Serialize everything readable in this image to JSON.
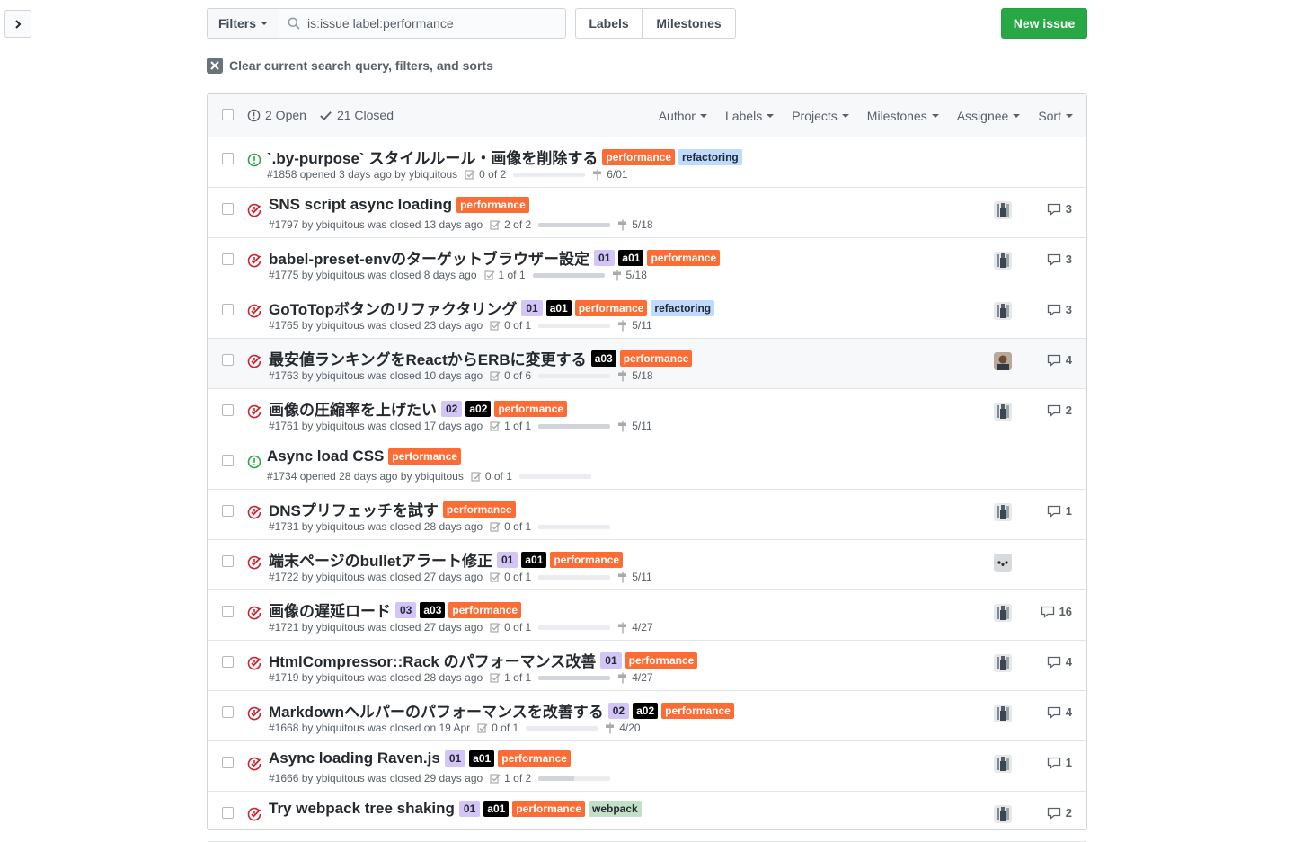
{
  "search": {
    "filters_label": "Filters",
    "query": "is:issue label:performance"
  },
  "nav": {
    "labels": "Labels",
    "milestones": "Milestones",
    "new_issue": "New issue"
  },
  "clear_query": "Clear current search query, filters, and sorts",
  "states": {
    "open": "2 Open",
    "closed": "21 Closed"
  },
  "header_filters": [
    "Author",
    "Labels",
    "Projects",
    "Milestones",
    "Assignee",
    "Sort"
  ],
  "colors": {
    "performance": "#fc6c35",
    "refactoring": "#bfdaff",
    "open": "#28a745",
    "closed": "#cb2431",
    "new_issue": "#28a745"
  },
  "issues": [
    {
      "title": "`.by-purpose` スタイルルール・画像を削除する",
      "state": "open",
      "labels": [
        "performance",
        "refactoring"
      ],
      "meta": "#1858 opened 3 days ago by ybiquitous",
      "tasks": "0 of 2",
      "progress": 0,
      "milestone": "6/01",
      "comments": "",
      "avatar": "none"
    },
    {
      "title": "SNS script async loading",
      "state": "closed",
      "labels": [
        "performance"
      ],
      "meta": "#1797 by ybiquitous was closed 13 days ago",
      "tasks": "2 of 2",
      "progress": 1,
      "milestone": "5/18",
      "comments": "3",
      "avatar": "person"
    },
    {
      "title": "babel-preset-envのターゲットブラウザー設定",
      "state": "closed",
      "labels": [
        "01",
        "a01",
        "performance"
      ],
      "meta": "#1775 by ybiquitous was closed 8 days ago",
      "tasks": "1 of 1",
      "progress": 1,
      "milestone": "5/18",
      "comments": "3",
      "avatar": "person"
    },
    {
      "title": "GoToTopボタンのリファクタリング",
      "state": "closed",
      "labels": [
        "01",
        "a01",
        "performance",
        "refactoring"
      ],
      "meta": "#1765 by ybiquitous was closed 23 days ago",
      "tasks": "0 of 1",
      "progress": 0,
      "milestone": "5/11",
      "comments": "3",
      "avatar": "person"
    },
    {
      "title": "最安値ランキングをReactからERBに変更する",
      "state": "closed",
      "labels": [
        "a03",
        "performance"
      ],
      "meta": "#1763 by ybiquitous was closed 10 days ago",
      "tasks": "0 of 6",
      "progress": 0,
      "milestone": "5/18",
      "comments": "4",
      "avatar": "photo",
      "highlight": true
    },
    {
      "title": "画像の圧縮率を上げたい",
      "state": "closed",
      "labels": [
        "02",
        "a02",
        "performance"
      ],
      "meta": "#1761 by ybiquitous was closed 17 days ago",
      "tasks": "1 of 1",
      "progress": 1,
      "milestone": "5/11",
      "comments": "2",
      "avatar": "person"
    },
    {
      "title": "Async load CSS",
      "state": "open",
      "labels": [
        "performance"
      ],
      "meta": "#1734 opened 28 days ago by ybiquitous",
      "tasks": "0 of 1",
      "progress": 0,
      "milestone": "",
      "comments": "",
      "avatar": "none"
    },
    {
      "title": "DNSプリフェッチを試す",
      "state": "closed",
      "labels": [
        "performance"
      ],
      "meta": "#1731 by ybiquitous was closed 28 days ago",
      "tasks": "0 of 1",
      "progress": 0,
      "milestone": "",
      "comments": "1",
      "avatar": "person"
    },
    {
      "title": "端末ページのbulletアラート修正",
      "state": "closed",
      "labels": [
        "01",
        "a01",
        "performance"
      ],
      "meta": "#1722 by ybiquitous was closed 27 days ago",
      "tasks": "0 of 1",
      "progress": 0,
      "milestone": "5/11",
      "comments": "",
      "avatar": "koala"
    },
    {
      "title": "画像の遅延ロード",
      "state": "closed",
      "labels": [
        "03",
        "a03",
        "performance"
      ],
      "meta": "#1721 by ybiquitous was closed 27 days ago",
      "tasks": "0 of 1",
      "progress": 0,
      "milestone": "4/27",
      "comments": "16",
      "avatar": "person"
    },
    {
      "title": "HtmlCompressor::Rack のパフォーマンス改善",
      "state": "closed",
      "labels": [
        "01",
        "performance"
      ],
      "meta": "#1719 by ybiquitous was closed 28 days ago",
      "tasks": "1 of 1",
      "progress": 1,
      "milestone": "4/27",
      "comments": "4",
      "avatar": "person"
    },
    {
      "title": "Markdownヘルパーのパフォーマンスを改善する",
      "state": "closed",
      "labels": [
        "02",
        "a02",
        "performance"
      ],
      "meta": "#1668 by ybiquitous was closed on 19 Apr",
      "tasks": "0 of 1",
      "progress": 0,
      "milestone": "4/20",
      "comments": "4",
      "avatar": "person"
    },
    {
      "title": "Async loading Raven.js",
      "state": "closed",
      "labels": [
        "01",
        "a01",
        "performance"
      ],
      "meta": "#1666 by ybiquitous was closed 29 days ago",
      "tasks": "1 of 2",
      "progress": 0.5,
      "milestone": "",
      "comments": "1",
      "avatar": "person"
    },
    {
      "title": "Try webpack tree shaking",
      "state": "closed",
      "labels": [
        "01",
        "a01",
        "performance",
        "webpack"
      ],
      "meta": "",
      "tasks": "",
      "progress": 0,
      "milestone": "",
      "comments": "2",
      "avatar": "person"
    }
  ]
}
